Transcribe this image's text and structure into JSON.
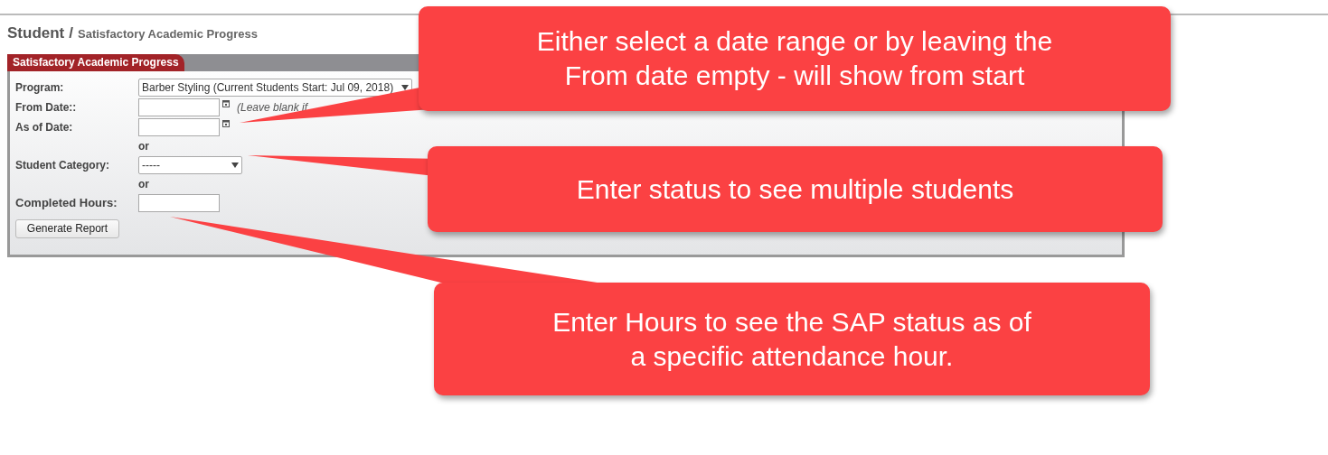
{
  "breadcrumb": {
    "section": "Student",
    "separator": "/",
    "page": "Satisfactory Academic Progress"
  },
  "panel": {
    "title": "Satisfactory Academic Progress"
  },
  "form": {
    "program": {
      "label": "Program:",
      "value": "Barber Styling (Current Students Start: Jul 09, 2018)"
    },
    "from_date": {
      "label": "From Date::",
      "hint": "(Leave blank if"
    },
    "as_of_date": {
      "label": "As of Date:"
    },
    "or_1": "or",
    "student_category": {
      "label": "Student Category:",
      "value": "-----"
    },
    "or_2": "or",
    "completed_hours": {
      "label": "Completed Hours:"
    },
    "button": "Generate Report"
  },
  "callouts": [
    {
      "lines": [
        "Either select a date range or by leaving the",
        "From date empty - will show from start"
      ]
    },
    {
      "lines": [
        "Enter status to see multiple students"
      ]
    },
    {
      "lines": [
        "Enter Hours to see the SAP status as of",
        "a specific attendance hour."
      ]
    }
  ]
}
